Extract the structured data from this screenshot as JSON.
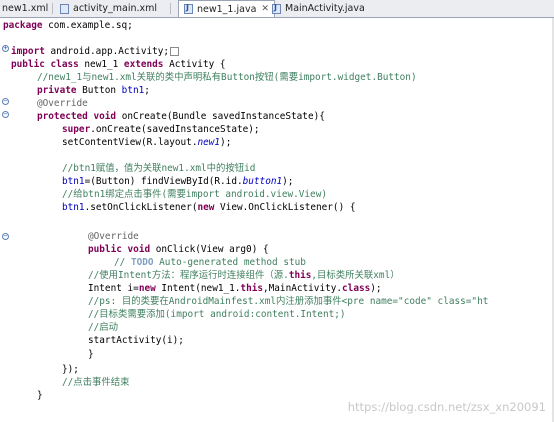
{
  "tabs": [
    {
      "label": "new1.xml",
      "active": false,
      "closable": false
    },
    {
      "label": "activity_main.xml",
      "active": false,
      "closable": false
    },
    {
      "label": "new1_1.java",
      "active": true,
      "closable": true
    },
    {
      "label": "MainActivity.java",
      "active": false,
      "closable": false
    }
  ],
  "code": {
    "l1": {
      "kw": "package",
      "rest": " com.example.sq;"
    },
    "l2": {
      "kw": "import",
      "rest": " android.app.Activity;"
    },
    "l3": {
      "kw1": "public",
      "kw2": "class",
      "mid": " new1_1 ",
      "kw3": "extends",
      "rest": " Activity {"
    },
    "l4": {
      "comment": "//new1_1与new1.xml关联的类中声明私有Button按钮(需要import.widget.Button)"
    },
    "l5": {
      "kw": "private",
      "type": " Button ",
      "field": "btn1",
      "rest": ";"
    },
    "l6": {
      "annotation": "@Override"
    },
    "l7": {
      "kw1": "protected",
      "kw2": "void",
      "rest": " onCreate(Bundle savedInstanceState){"
    },
    "l8": {
      "kw": "super",
      "rest": ".onCreate(savedInstanceState);"
    },
    "l9": {
      "pre": "setContentView(R.layout.",
      "field": "new1",
      "rest": ");"
    },
    "l10": {
      "comment": "//btn1赋值，值为关联new1.xml中的按钮id"
    },
    "l11": {
      "field": "btn1",
      "pre": "=(Button) findViewById(R.id.",
      "field2": "button1",
      "rest": ");"
    },
    "l12": {
      "comment": "//给btn1绑定点击事件(需要import android.view.View)"
    },
    "l13": {
      "field": "btn1",
      "pre": ".setOnClickListener(",
      "kw": "new",
      "rest": " View.OnClickListener() {"
    },
    "l14": {
      "annotation": "@Override"
    },
    "l15": {
      "kw1": "public",
      "kw2": "void",
      "rest": " onClick(View arg0) {"
    },
    "l16": {
      "comment1": "// ",
      "task": "TODO",
      "comment2": " Auto-generated method stub"
    },
    "l17": {
      "comment1": "//使用Intent方法：程序运行时连接组件（源.",
      "kwc": "this",
      "comment2": ",目标类所关联xml）"
    },
    "l18": {
      "pre": "Intent i=",
      "kw": "new",
      "mid": " Intent(new1_1.",
      "kw2": "this",
      "mid2": ",MainActivity.",
      "kw3": "class",
      "rest": ");"
    },
    "l19": {
      "comment": "//ps: 目的类要在AndroidMainfest.xml内注册添加事件<pre name=\"code\" class=\"ht"
    },
    "l20": {
      "comment": "//目标类需要添加(import android:content.Intent;)"
    },
    "l21": {
      "comment": "//启动"
    },
    "l22": {
      "rest": "startActivity(i);"
    },
    "l23": {
      "rest": "}"
    },
    "l24": {
      "rest": "});"
    },
    "l25": {
      "comment": "//点击事件结束"
    },
    "l26": {
      "rest": "}"
    }
  },
  "watermark": "https://blog.csdn.net/zsx_xn20091",
  "colors": {
    "keyword": "#7f0055",
    "comment": "#3f7f5f",
    "field": "#0000c0",
    "annotation": "#646464",
    "tab_bg": "#ecedf0"
  }
}
